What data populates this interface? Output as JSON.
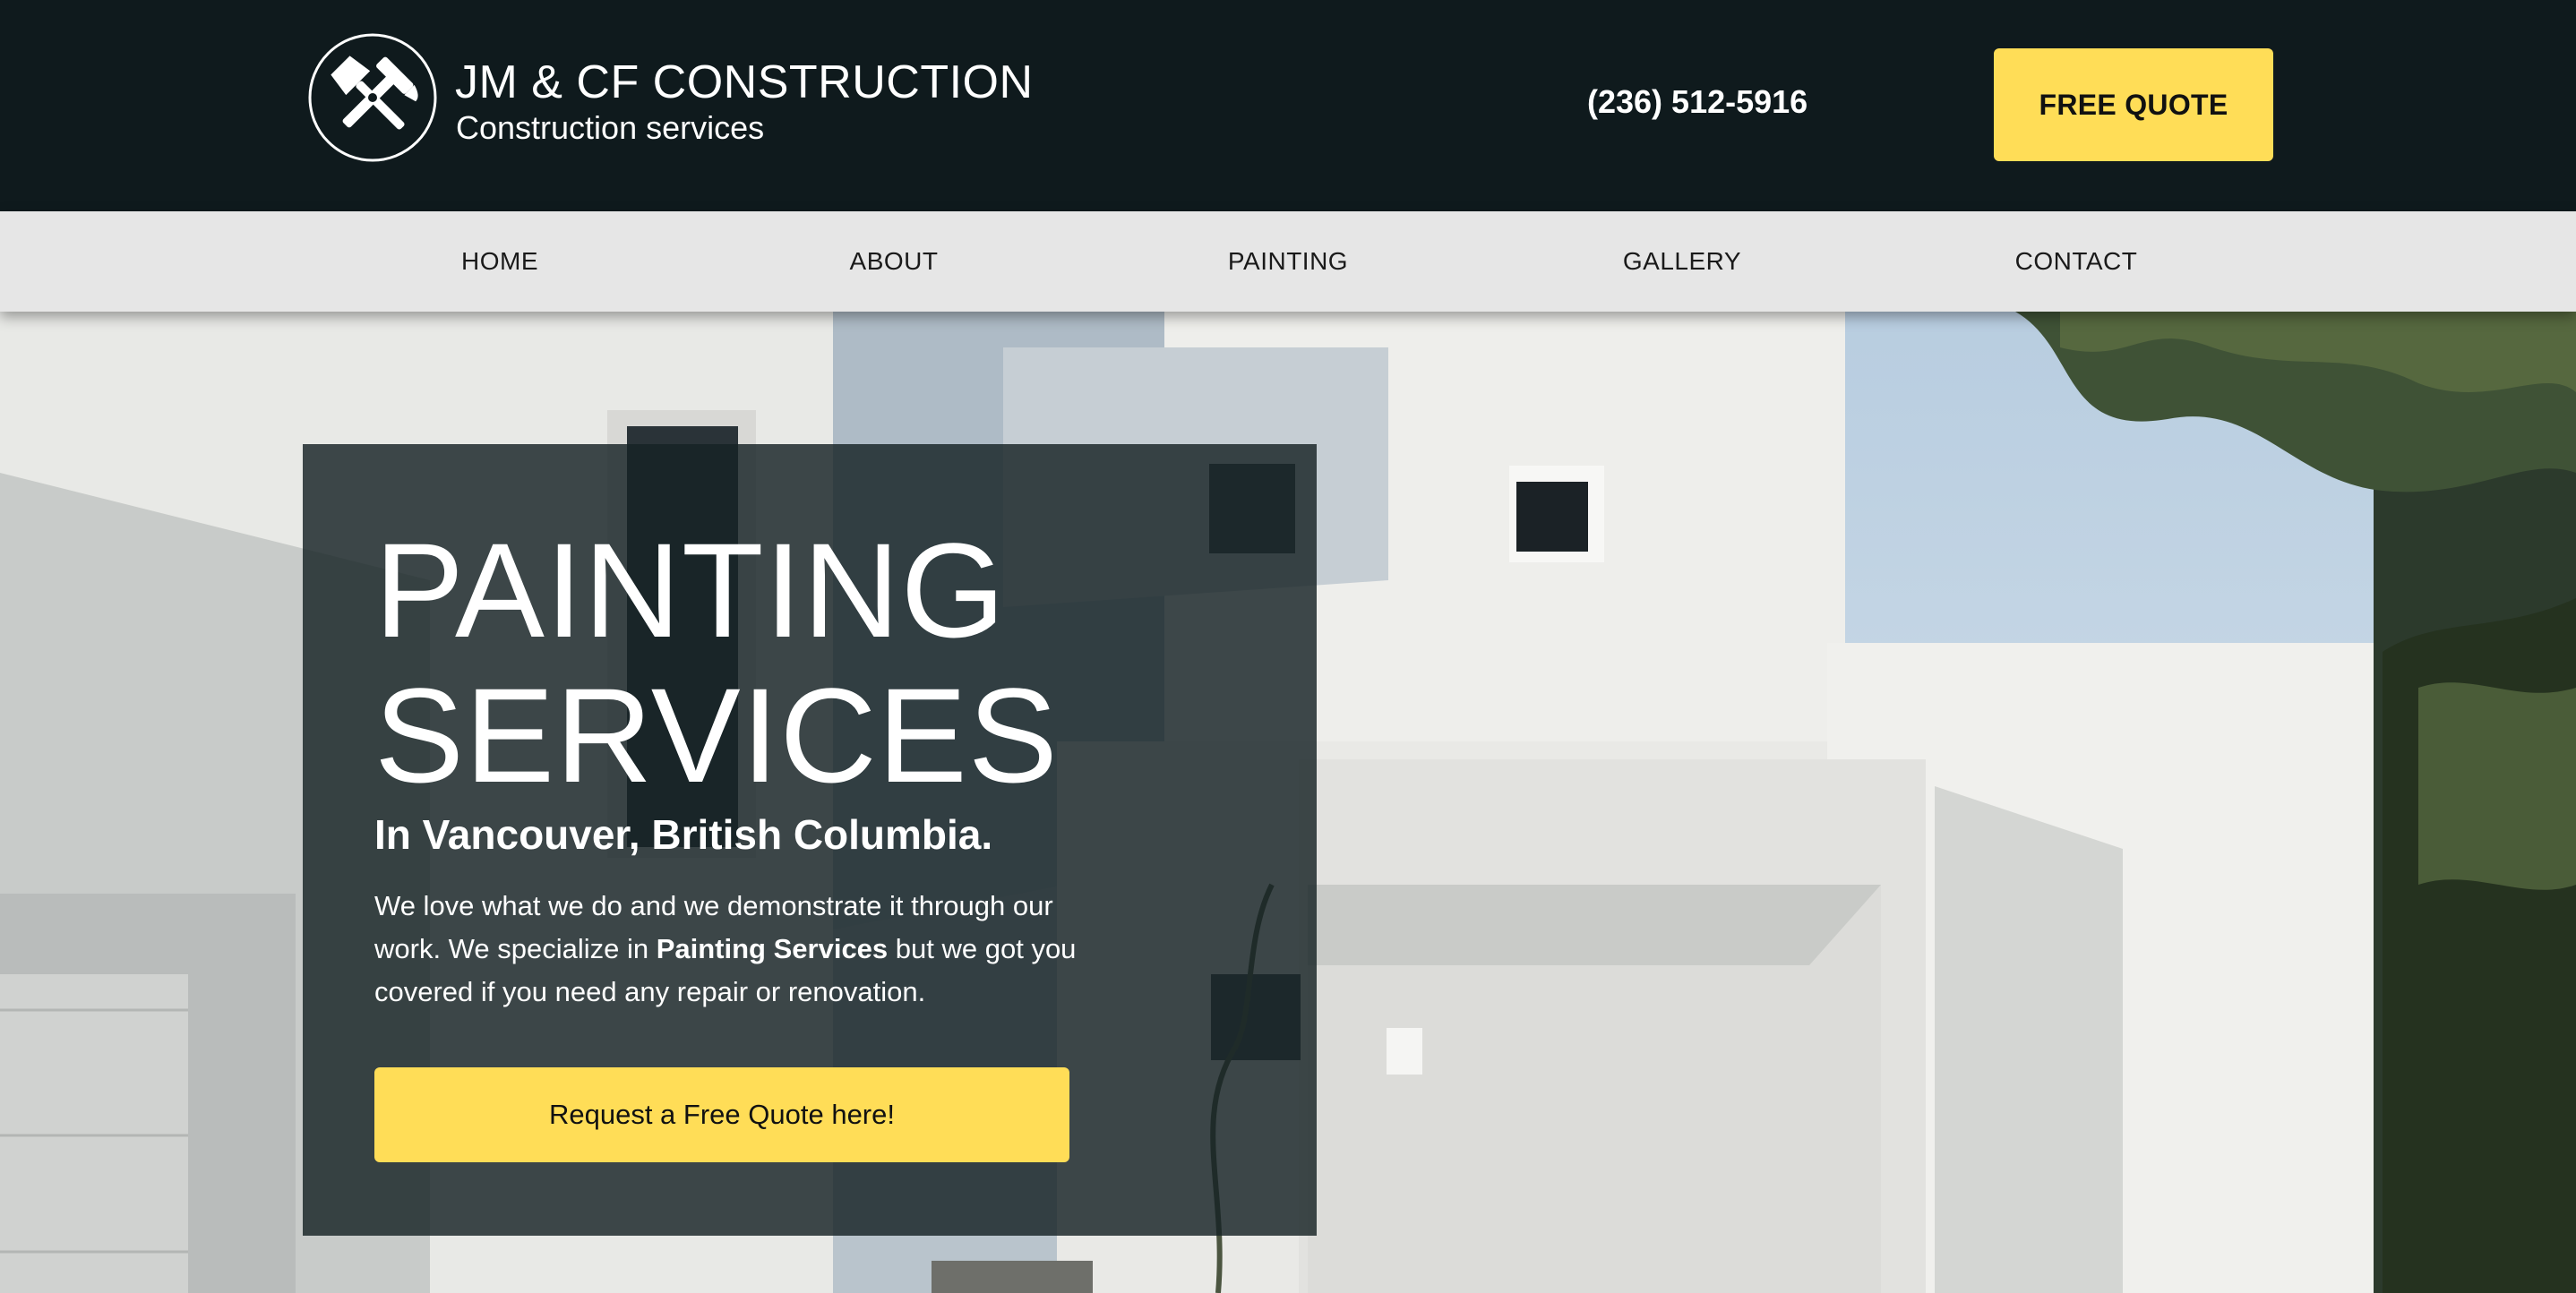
{
  "header": {
    "brand_title": "JM & CF CONSTRUCTION",
    "brand_subtitle": "Construction services",
    "logo_icon": "hammer-and-trowel-icon",
    "phone": "(236) 512-5916",
    "cta_label": "FREE QUOTE"
  },
  "nav": {
    "items": [
      {
        "label": "HOME"
      },
      {
        "label": "ABOUT"
      },
      {
        "label": "PAINTING"
      },
      {
        "label": "GALLERY"
      },
      {
        "label": "CONTACT"
      }
    ]
  },
  "hero": {
    "title_line1": "PAINTING",
    "title_line2": "SERVICES",
    "subtitle": "In Vancouver, British Columbia.",
    "text_part1": "We love what we do and we demonstrate it through our work. We specialize in ",
    "text_bold": "Painting Services",
    "text_part2": " but we got you covered if you need any repair or renovation.",
    "cta_label": "Request a Free Quote here!"
  },
  "colors": {
    "header_bg": "#0f1a1d",
    "nav_bg": "#e6e6e6",
    "accent_yellow": "#ffdd57",
    "panel_bg": "#162224"
  }
}
